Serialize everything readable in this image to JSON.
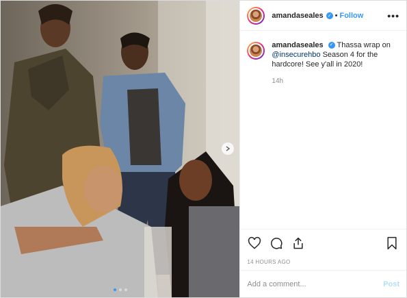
{
  "header": {
    "username": "amandaseales",
    "separator": "•",
    "follow_label": "Follow",
    "more_label": "•••"
  },
  "caption": {
    "username": "amandaseales",
    "text_before": "Thassa wrap on ",
    "mention": "@insecurehbo",
    "text_after": " Season 4 for the hardcore! See y'all in 2020!",
    "relative_time": "14h"
  },
  "actions": {
    "icons": [
      "heart-icon",
      "comment-icon",
      "share-icon",
      "bookmark-icon"
    ]
  },
  "timestamp": "14 HOURS AGO",
  "comment_box": {
    "placeholder": "Add a comment...",
    "post_label": "Post"
  },
  "carousel": {
    "slide_count": 3,
    "active_index": 0
  },
  "colors": {
    "accent": "#3897f0",
    "post_disabled": "#b2dffc",
    "muted": "#8e8e8e"
  }
}
